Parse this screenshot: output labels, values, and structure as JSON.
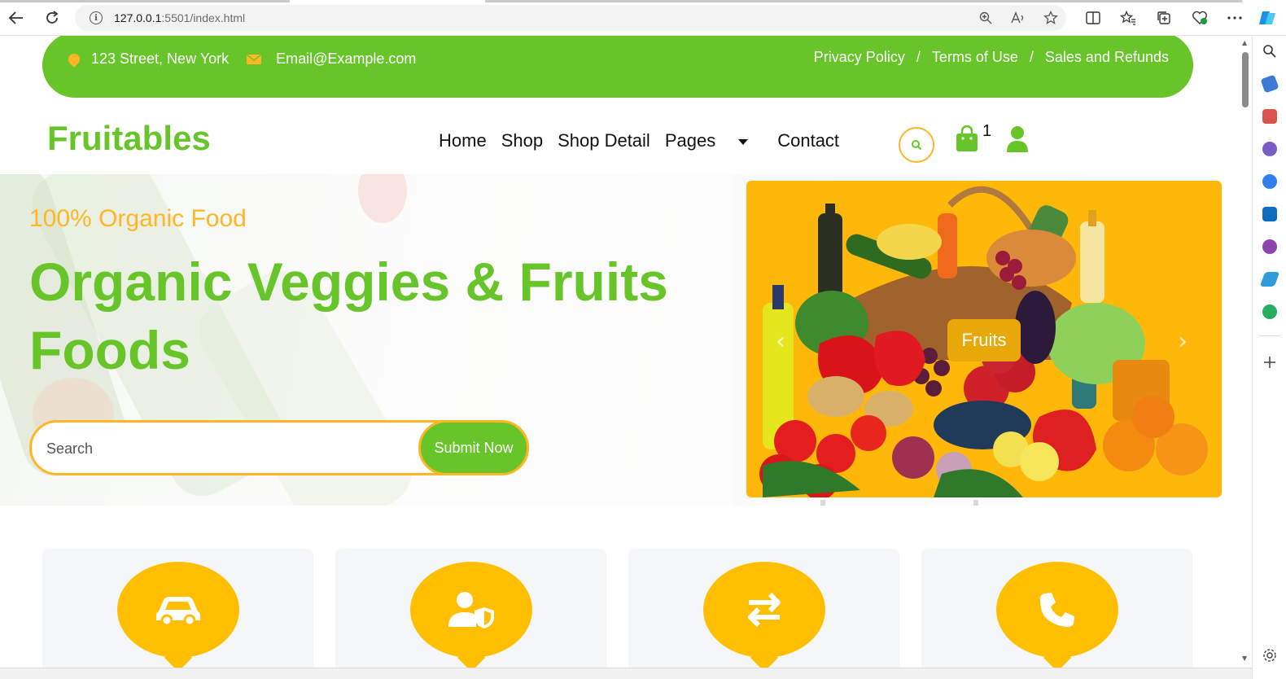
{
  "browser": {
    "url_host": "127.0.0.1",
    "url_rest": ":5501/index.html"
  },
  "topbar": {
    "address": "123 Street, New York",
    "email": "Email@Example.com",
    "links": [
      "Privacy Policy",
      "Terms of Use",
      "Sales and Refunds"
    ],
    "separator": "/"
  },
  "navbar": {
    "brand": "Fruitables",
    "menu": [
      "Home",
      "Shop",
      "Shop Detail",
      "Pages",
      "Contact"
    ],
    "cart_count": "1"
  },
  "hero": {
    "tagline": "100% Organic Food",
    "headline": "Organic Veggies & Fruits Foods",
    "search_placeholder": "Search",
    "submit_label": "Submit Now",
    "carousel_label": "Fruits"
  },
  "features": {
    "icons": [
      "car-icon",
      "user-shield-icon",
      "exchange-arrows-icon",
      "phone-icon"
    ]
  },
  "colors": {
    "primary_green": "#67c52a",
    "accent_yellow": "#ffb524"
  }
}
